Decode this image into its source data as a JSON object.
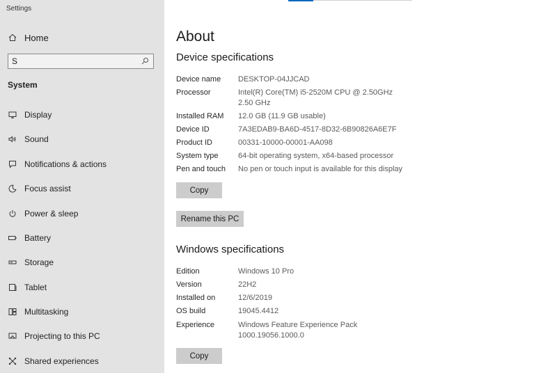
{
  "window": {
    "title": "Settings"
  },
  "sidebar": {
    "home_label": "Home",
    "search": {
      "value": "S",
      "placeholder": ""
    },
    "section_label": "System",
    "items": [
      {
        "label": "Display",
        "icon": "display-icon"
      },
      {
        "label": "Sound",
        "icon": "sound-icon"
      },
      {
        "label": "Notifications & actions",
        "icon": "notifications-icon"
      },
      {
        "label": "Focus assist",
        "icon": "focus-assist-icon"
      },
      {
        "label": "Power & sleep",
        "icon": "power-icon"
      },
      {
        "label": "Battery",
        "icon": "battery-icon"
      },
      {
        "label": "Storage",
        "icon": "storage-icon"
      },
      {
        "label": "Tablet",
        "icon": "tablet-icon"
      },
      {
        "label": "Multitasking",
        "icon": "multitasking-icon"
      },
      {
        "label": "Projecting to this PC",
        "icon": "projecting-icon"
      },
      {
        "label": "Shared experiences",
        "icon": "shared-experiences-icon"
      }
    ]
  },
  "main": {
    "title": "About",
    "device_specs": {
      "heading": "Device specifications",
      "rows": [
        {
          "key": "Device name",
          "value": "DESKTOP-04JJCAD"
        },
        {
          "key": "Processor",
          "value": "Intel(R) Core(TM) i5-2520M CPU @ 2.50GHz",
          "value2": "2.50 GHz"
        },
        {
          "key": "Installed RAM",
          "value": "12.0 GB (11.9 GB usable)"
        },
        {
          "key": "Device ID",
          "value": "7A3EDAB9-BA6D-4517-8D32-6B90826A6E7F"
        },
        {
          "key": "Product ID",
          "value": "00331-10000-00001-AA098"
        },
        {
          "key": "System type",
          "value": "64-bit operating system, x64-based processor"
        },
        {
          "key": "Pen and touch",
          "value": "No pen or touch input is available for this display"
        }
      ],
      "copy_label": "Copy",
      "rename_label": "Rename this PC"
    },
    "windows_specs": {
      "heading": "Windows specifications",
      "rows": [
        {
          "key": "Edition",
          "value": "Windows 10 Pro"
        },
        {
          "key": "Version",
          "value": "22H2"
        },
        {
          "key": "Installed on",
          "value": "12/6/2019"
        },
        {
          "key": "OS build",
          "value": "19045.4412"
        },
        {
          "key": "Experience",
          "value": "Windows Feature Experience Pack",
          "value2": "1000.19056.1000.0"
        }
      ],
      "copy_label": "Copy"
    }
  }
}
